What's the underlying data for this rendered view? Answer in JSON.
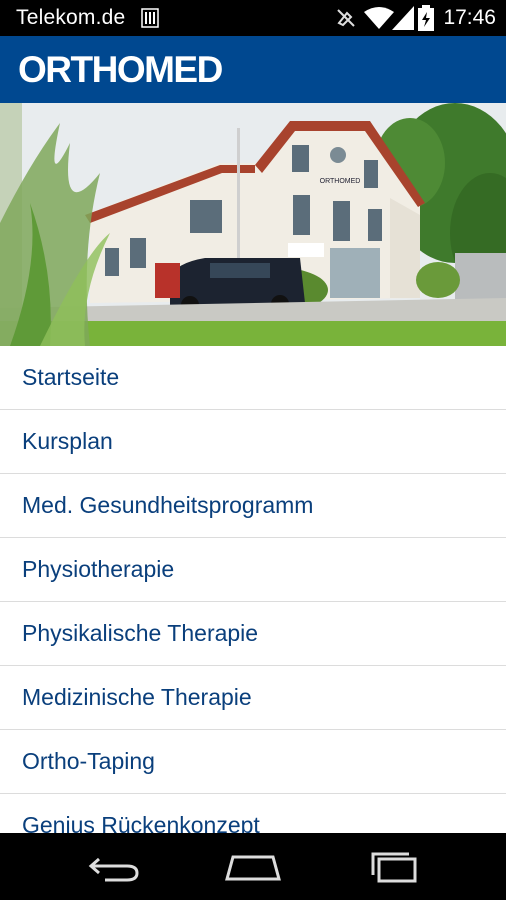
{
  "status_bar": {
    "carrier": "Telekom.de",
    "time": "17:46",
    "icons": [
      "sim-card-icon",
      "mute-icon",
      "wifi-icon",
      "signal-icon",
      "battery-charging-icon"
    ]
  },
  "app_bar": {
    "logo_text": "ORTHOMED",
    "background_color": "#004890"
  },
  "hero": {
    "building_sign": "ORTHOMED",
    "description_icon": "clinic-building-photo"
  },
  "menu": {
    "items": [
      {
        "label": "Startseite"
      },
      {
        "label": "Kursplan"
      },
      {
        "label": "Med. Gesundheitsprogramm"
      },
      {
        "label": "Physiotherapie"
      },
      {
        "label": "Physikalische Therapie"
      },
      {
        "label": "Medizinische Therapie"
      },
      {
        "label": "Ortho-Taping"
      },
      {
        "label": "Genius Rückenkonzept"
      }
    ],
    "text_color": "#0a3f7c"
  },
  "nav_bar": {
    "buttons": [
      "back-icon",
      "home-icon",
      "recents-icon"
    ]
  }
}
